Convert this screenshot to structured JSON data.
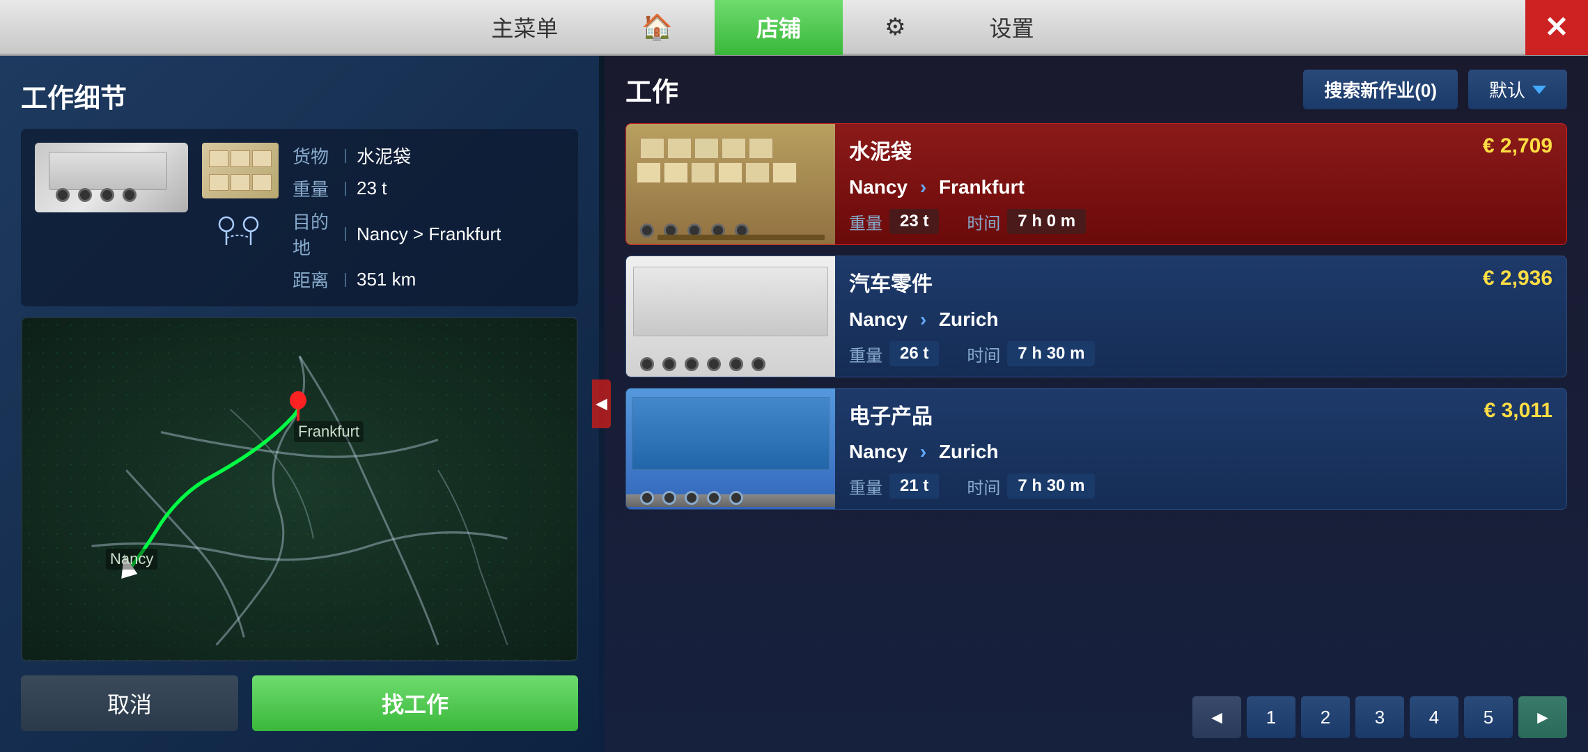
{
  "nav": {
    "main_menu": "主菜单",
    "home_icon": "🏠",
    "shop": "店铺",
    "gear_icon": "⚙",
    "settings": "设置",
    "close": "✕"
  },
  "left_panel": {
    "title": "工作细节",
    "cargo_label": "货物",
    "cargo_value": "水泥袋",
    "weight_label": "重量",
    "weight_value": "23 t",
    "destination_label": "目的地",
    "destination_value": "Nancy > Frankfurt",
    "distance_label": "距离",
    "distance_value": "351 km",
    "city_from": "Nancy",
    "city_to": "Frankfurt",
    "btn_cancel": "取消",
    "btn_find": "找工作"
  },
  "right_panel": {
    "title": "工作",
    "search_btn": "搜索新作业(0)",
    "default_btn": "默认",
    "jobs": [
      {
        "id": 1,
        "cargo": "水泥袋",
        "price": "€ 2,709",
        "from": "Nancy",
        "to": "Frankfurt",
        "weight": "23 t",
        "time": "7 h 0 m",
        "selected": true,
        "trailer_type": "flat"
      },
      {
        "id": 2,
        "cargo": "汽车零件",
        "price": "€ 2,936",
        "from": "Nancy",
        "to": "Zurich",
        "weight": "26 t",
        "time": "7 h 30 m",
        "selected": false,
        "trailer_type": "white"
      },
      {
        "id": 3,
        "cargo": "电子产品",
        "price": "€ 3,011",
        "from": "Nancy",
        "to": "Zurich",
        "weight": "21 t",
        "time": "7 h 30 m",
        "selected": false,
        "trailer_type": "blue"
      }
    ],
    "pagination": {
      "prev_arrow": "◄",
      "next_arrow": "►",
      "pages": [
        "1",
        "2",
        "3",
        "4",
        "5"
      ]
    },
    "labels": {
      "weight": "重量",
      "time": "时间"
    }
  }
}
